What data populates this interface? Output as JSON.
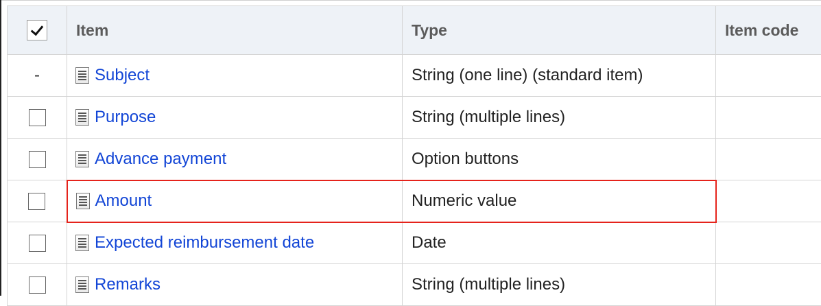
{
  "table": {
    "headers": {
      "item": "Item",
      "type": "Type",
      "item_code": "Item code"
    },
    "rows": [
      {
        "selectable": false,
        "marker": "-",
        "item": "Subject",
        "type": "String (one line) (standard item)",
        "item_code": ""
      },
      {
        "selectable": true,
        "marker": "",
        "item": "Purpose",
        "type": "String (multiple lines)",
        "item_code": ""
      },
      {
        "selectable": true,
        "marker": "",
        "item": "Advance payment",
        "type": "Option buttons",
        "item_code": ""
      },
      {
        "selectable": true,
        "marker": "",
        "item": "Amount",
        "type": "Numeric value",
        "item_code": "",
        "highlighted": true
      },
      {
        "selectable": true,
        "marker": "",
        "item": "Expected reimbursement date",
        "type": "Date",
        "item_code": ""
      },
      {
        "selectable": true,
        "marker": "",
        "item": "Remarks",
        "type": "String (multiple lines)",
        "item_code": ""
      }
    ]
  },
  "icons": {
    "select_all": "checkmark-icon",
    "item": "document-icon"
  },
  "colors": {
    "link": "#1245d6",
    "highlight_border": "#e5231b",
    "header_background": "#eef2f7"
  }
}
